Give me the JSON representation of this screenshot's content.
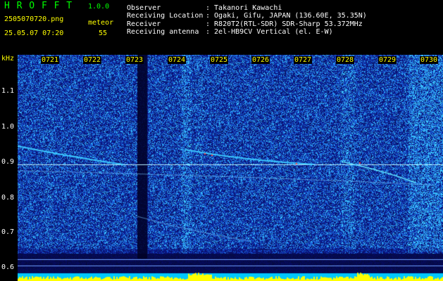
{
  "header": {
    "app_name": "H R O F F T",
    "version": "1.0.0",
    "filename": "2505070720.png",
    "type_label": "meteor",
    "datetime": "25.05.07 07:20",
    "count": "55",
    "fields": [
      {
        "label": "Observer",
        "value": ": Takanori Kawachi"
      },
      {
        "label": "Receiving Location",
        "value": ": Ogaki, Gifu, JAPAN (136.60E, 35.35N)"
      },
      {
        "label": "Receiver",
        "value": ": R820T2(RTL-SDR) SDR-Sharp 53.372MHz"
      },
      {
        "label": "Receiving antenna",
        "value": ": 2el-HB9CV Vertical (el. E-W)"
      }
    ]
  },
  "y_axis": {
    "unit": "kHz",
    "ticks": [
      "1.1",
      "1.0",
      "0.9",
      "0.8",
      "0.7",
      "0.6"
    ],
    "range": [
      0.58,
      1.18
    ]
  },
  "x_axis": {
    "ticks": [
      "0721",
      "0722",
      "0723",
      "0724",
      "0725",
      "0726",
      "0727",
      "0728",
      "0729",
      "0730"
    ]
  },
  "colors": {
    "background": "#000000",
    "header_text": "#ffffff",
    "title_color": "#00ff00",
    "tick_label": "#ffff00",
    "spectrogram_base": "#0a1aa0",
    "signal_line": "#40d8ff",
    "level_bar": "#ffff00",
    "level_base": "#00c8ff"
  }
}
